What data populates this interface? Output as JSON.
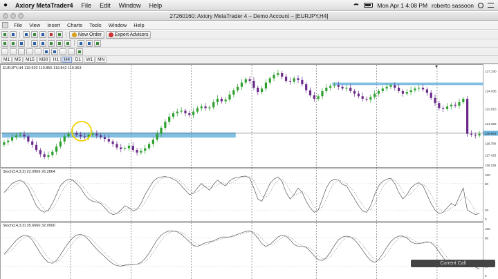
{
  "menubar": {
    "app_name": "Axiory MetaTrader4",
    "items": [
      "File",
      "Edit",
      "Window",
      "Help"
    ],
    "clock": "Mon Apr 1  4:08 PM",
    "user": "roberto sassoon"
  },
  "window": {
    "title": "27260160: Axiory MetaTrader 4 – Demo Account – [EURJPY,H4]"
  },
  "appmenu": {
    "items": [
      "File",
      "View",
      "Insert",
      "Charts",
      "Tools",
      "Window",
      "Help"
    ]
  },
  "toolbar": {
    "new_order": "New Order",
    "expert_advisors": "Expert Advisors"
  },
  "timeframes": [
    "M1",
    "M5",
    "M15",
    "M30",
    "H1",
    "H4",
    "D1",
    "W1",
    "MN"
  ],
  "active_timeframe": "H4",
  "chart": {
    "header": "EURJPY,H4  119.920 119.855 119.842 119.963",
    "price_labels": [
      "127.240",
      "124.935",
      "122.815",
      "121.095",
      "119.963",
      "118.780",
      "117.425",
      "116.235"
    ],
    "current_price": "119.963",
    "stoch1_label": "Stoch(14,3,3) 22.0966 26.2864",
    "stoch2_label": "Stoch(14,3,3) 35.6660 32.0900",
    "osc_levels": [
      "100",
      "80",
      "20",
      "0"
    ],
    "colors": {
      "bull": "#2ea02e",
      "bear": "#6a2a8a",
      "zone": "#6ab4dc",
      "period_sep": "#555555"
    }
  },
  "chart_data": {
    "type": "candlestick",
    "symbol": "EURJPY",
    "timeframe": "H4",
    "ylim": [
      116.235,
      127.24
    ],
    "closes": [
      118.9,
      119.1,
      119.5,
      119.7,
      119.8,
      119.6,
      119.0,
      118.6,
      118.0,
      117.5,
      117.2,
      117.4,
      117.8,
      118.4,
      119.0,
      119.6,
      119.9,
      120.0,
      119.8,
      119.6,
      119.5,
      119.8,
      119.9,
      119.7,
      119.5,
      119.3,
      119.0,
      118.7,
      118.3,
      118.1,
      118.2,
      118.5,
      118.0,
      117.7,
      117.9,
      118.2,
      118.7,
      119.2,
      119.9,
      120.6,
      121.3,
      121.9,
      122.3,
      122.5,
      122.6,
      122.3,
      122.1,
      122.5,
      122.9,
      123.1,
      122.9,
      123.0,
      123.6,
      124.0,
      123.7,
      123.9,
      124.5,
      125.0,
      125.4,
      125.9,
      126.3,
      126.1,
      125.3,
      124.8,
      125.2,
      125.9,
      126.4,
      126.8,
      127.0,
      126.6,
      126.1,
      126.0,
      126.4,
      126.2,
      125.7,
      125.0,
      124.4,
      124.0,
      124.3,
      124.9,
      125.3,
      125.5,
      125.6,
      125.4,
      125.2,
      125.3,
      124.9,
      124.6,
      124.3,
      124.0,
      123.9,
      124.2,
      124.6,
      124.9,
      125.2,
      125.4,
      125.6,
      125.3,
      124.9,
      124.6,
      124.8,
      125.0,
      125.2,
      125.3,
      125.1,
      124.7,
      124.1,
      123.5,
      122.9,
      122.8,
      123.1,
      123.3,
      123.2,
      123.6,
      124.0,
      119.9,
      119.8,
      119.7,
      119.9
    ],
    "zones": [
      {
        "low": 119.45,
        "high": 120.05,
        "from": 0,
        "to": 58
      },
      {
        "low": 125.6,
        "high": 125.9,
        "from": 82,
        "to": 120
      }
    ],
    "stoch1_main": [
      60,
      70,
      80,
      85,
      88,
      82,
      70,
      50,
      30,
      20,
      15,
      20,
      35,
      55,
      75,
      85,
      90,
      88,
      80,
      70,
      55,
      45,
      40,
      38,
      35,
      25,
      15,
      10,
      12,
      20,
      30,
      25,
      18,
      22,
      35,
      55,
      70,
      85,
      92,
      95,
      96,
      94,
      90,
      85,
      75,
      65,
      55,
      58,
      70,
      80,
      72,
      65,
      78,
      88,
      80,
      75,
      86,
      92,
      94,
      96,
      97,
      92,
      70,
      45,
      40,
      60,
      80,
      90,
      95,
      85,
      60,
      45,
      55,
      70,
      60,
      40,
      25,
      15,
      20,
      45,
      70,
      85,
      90,
      88,
      78,
      75,
      60,
      45,
      30,
      18,
      15,
      30,
      55,
      75,
      85,
      90,
      92,
      80,
      60,
      45,
      55,
      70,
      78,
      82,
      75,
      55,
      35,
      20,
      12,
      15,
      25,
      35,
      30,
      50,
      70,
      20,
      15,
      10,
      12
    ],
    "stoch2_main": [
      45,
      55,
      65,
      75,
      82,
      86,
      84,
      76,
      62,
      48,
      36,
      28,
      26,
      32,
      44,
      58,
      70,
      80,
      86,
      88,
      84,
      76,
      66,
      56,
      48,
      40,
      32,
      25,
      21,
      20,
      22,
      24,
      24,
      24,
      28,
      36,
      48,
      62,
      76,
      86,
      92,
      95,
      95,
      93,
      88,
      80,
      72,
      64,
      62,
      66,
      70,
      72,
      74,
      78,
      82,
      82,
      82,
      85,
      88,
      91,
      94,
      95,
      90,
      80,
      68,
      62,
      66,
      74,
      82,
      86,
      84,
      76,
      66,
      62,
      62,
      60,
      52,
      42,
      34,
      32,
      38,
      50,
      64,
      76,
      82,
      84,
      82,
      76,
      66,
      54,
      42,
      32,
      28,
      34,
      46,
      60,
      72,
      80,
      84,
      84,
      80,
      72,
      68,
      68,
      70,
      72,
      70,
      62,
      50,
      38,
      28,
      22,
      22,
      26,
      32,
      30,
      24,
      18,
      14
    ]
  },
  "notification": "Current Call"
}
